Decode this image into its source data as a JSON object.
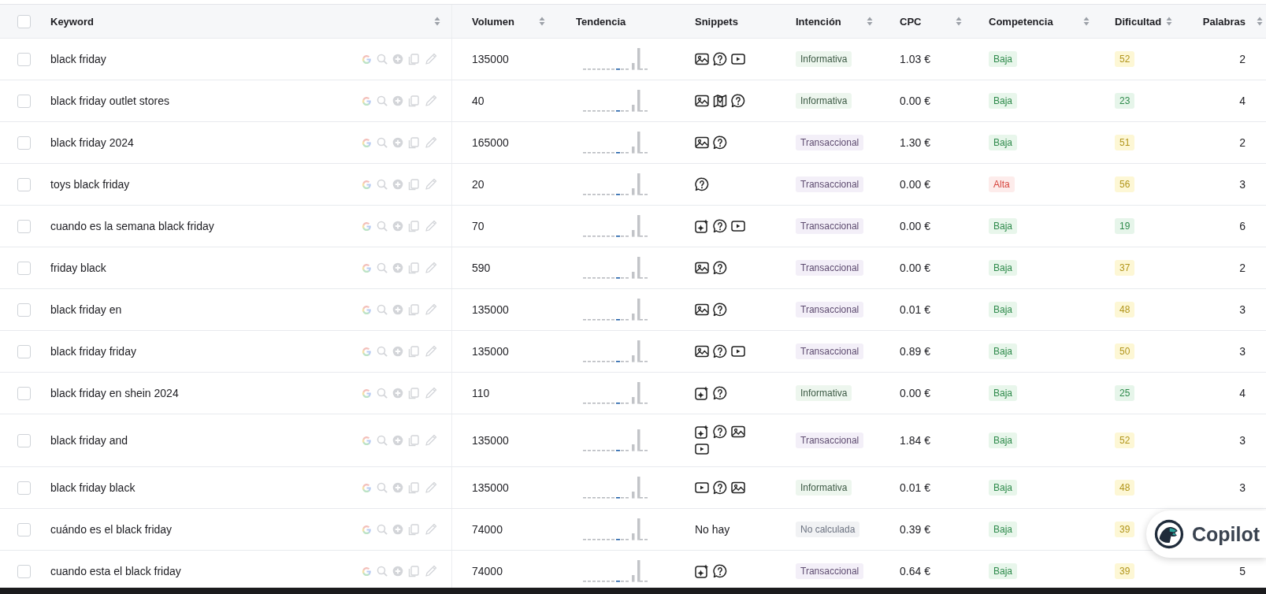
{
  "header": {
    "checkbox": {
      "checked": false
    },
    "columns": [
      {
        "label": "Keyword",
        "sortable": true
      },
      {
        "label": "Volumen",
        "sortable": true
      },
      {
        "label": "Tendencia",
        "sortable": false
      },
      {
        "label": "Snippets",
        "sortable": false
      },
      {
        "label": "Intención",
        "sortable": true
      },
      {
        "label": "CPC",
        "sortable": true
      },
      {
        "label": "Competencia",
        "sortable": true
      },
      {
        "label": "Dificultad",
        "sortable": true
      },
      {
        "label": "Palabras",
        "sortable": true
      }
    ]
  },
  "rows": [
    {
      "checked": false,
      "keyword": "black friday",
      "volume": "135000",
      "snippets": [
        {
          "kind": "image"
        },
        {
          "kind": "question"
        },
        {
          "kind": "video"
        }
      ],
      "intent": {
        "label": "Informativa",
        "kind": "informational"
      },
      "cpc": "1.03 €",
      "competition": {
        "label": "Baja",
        "kind": "low"
      },
      "difficulty": {
        "value": "52",
        "kind": "medium"
      },
      "words": "2"
    },
    {
      "checked": false,
      "keyword": "black friday outlet stores",
      "volume": "40",
      "snippets": [
        {
          "kind": "image"
        },
        {
          "kind": "map"
        },
        {
          "kind": "question"
        }
      ],
      "intent": {
        "label": "Informativa",
        "kind": "informational"
      },
      "cpc": "0.00 €",
      "competition": {
        "label": "Baja",
        "kind": "low"
      },
      "difficulty": {
        "value": "23",
        "kind": "easy"
      },
      "words": "4"
    },
    {
      "checked": false,
      "keyword": "black friday 2024",
      "volume": "165000",
      "snippets": [
        {
          "kind": "image"
        },
        {
          "kind": "question"
        }
      ],
      "intent": {
        "label": "Transaccional",
        "kind": "transactional"
      },
      "cpc": "1.30 €",
      "competition": {
        "label": "Baja",
        "kind": "low"
      },
      "difficulty": {
        "value": "51",
        "kind": "medium"
      },
      "words": "2"
    },
    {
      "checked": false,
      "keyword": "toys black friday",
      "volume": "20",
      "snippets": [
        {
          "kind": "question"
        }
      ],
      "intent": {
        "label": "Transaccional",
        "kind": "transactional"
      },
      "cpc": "0.00 €",
      "competition": {
        "label": "Alta",
        "kind": "high"
      },
      "difficulty": {
        "value": "56",
        "kind": "medium"
      },
      "words": "3"
    },
    {
      "checked": false,
      "keyword": "cuando es la semana black friday",
      "volume": "70",
      "snippets": [
        {
          "kind": "ai"
        },
        {
          "kind": "question"
        },
        {
          "kind": "video"
        }
      ],
      "intent": {
        "label": "Transaccional",
        "kind": "transactional"
      },
      "cpc": "0.00 €",
      "competition": {
        "label": "Baja",
        "kind": "low"
      },
      "difficulty": {
        "value": "19",
        "kind": "easy"
      },
      "words": "6"
    },
    {
      "checked": false,
      "keyword": "friday black",
      "volume": "590",
      "snippets": [
        {
          "kind": "image"
        },
        {
          "kind": "question"
        }
      ],
      "intent": {
        "label": "Transaccional",
        "kind": "transactional"
      },
      "cpc": "0.00 €",
      "competition": {
        "label": "Baja",
        "kind": "low"
      },
      "difficulty": {
        "value": "37",
        "kind": "medium"
      },
      "words": "2"
    },
    {
      "checked": false,
      "keyword": "black friday en",
      "volume": "135000",
      "snippets": [
        {
          "kind": "image"
        },
        {
          "kind": "question"
        }
      ],
      "intent": {
        "label": "Transaccional",
        "kind": "transactional"
      },
      "cpc": "0.01 €",
      "competition": {
        "label": "Baja",
        "kind": "low"
      },
      "difficulty": {
        "value": "48",
        "kind": "medium"
      },
      "words": "3"
    },
    {
      "checked": false,
      "keyword": "black friday friday",
      "volume": "135000",
      "snippets": [
        {
          "kind": "image"
        },
        {
          "kind": "question"
        },
        {
          "kind": "video"
        }
      ],
      "intent": {
        "label": "Transaccional",
        "kind": "transactional"
      },
      "cpc": "0.89 €",
      "competition": {
        "label": "Baja",
        "kind": "low"
      },
      "difficulty": {
        "value": "50",
        "kind": "medium"
      },
      "words": "3"
    },
    {
      "checked": false,
      "keyword": "black friday en shein 2024",
      "volume": "110",
      "snippets": [
        {
          "kind": "ai"
        },
        {
          "kind": "question"
        }
      ],
      "intent": {
        "label": "Informativa",
        "kind": "informational"
      },
      "cpc": "0.00 €",
      "competition": {
        "label": "Baja",
        "kind": "low"
      },
      "difficulty": {
        "value": "25",
        "kind": "easy"
      },
      "words": "4"
    },
    {
      "checked": false,
      "keyword": "black friday and",
      "volume": "135000",
      "snippets": [
        {
          "kind": "ai"
        },
        {
          "kind": "question"
        },
        {
          "kind": "image"
        },
        {
          "kind": "video"
        }
      ],
      "intent": {
        "label": "Transaccional",
        "kind": "transactional"
      },
      "cpc": "1.84 €",
      "competition": {
        "label": "Baja",
        "kind": "low"
      },
      "difficulty": {
        "value": "52",
        "kind": "medium"
      },
      "words": "3"
    },
    {
      "checked": false,
      "keyword": "black friday black",
      "volume": "135000",
      "snippets": [
        {
          "kind": "video"
        },
        {
          "kind": "question"
        },
        {
          "kind": "image"
        }
      ],
      "intent": {
        "label": "Informativa",
        "kind": "informational"
      },
      "cpc": "0.01 €",
      "competition": {
        "label": "Baja",
        "kind": "low"
      },
      "difficulty": {
        "value": "48",
        "kind": "medium"
      },
      "words": "3"
    },
    {
      "checked": false,
      "keyword": "cuándo es el black friday",
      "volume": "74000",
      "snippets_text": "No hay",
      "intent": {
        "label": "No calculada",
        "kind": "none"
      },
      "cpc": "0.39 €",
      "competition": {
        "label": "Baja",
        "kind": "low"
      },
      "difficulty": {
        "value": "39",
        "kind": "medium"
      }
    },
    {
      "checked": false,
      "keyword": "cuando esta el black friday",
      "volume": "74000",
      "snippets": [
        {
          "kind": "ai"
        },
        {
          "kind": "question"
        }
      ],
      "intent": {
        "label": "Transaccional",
        "kind": "transactional"
      },
      "cpc": "0.64 €",
      "competition": {
        "label": "Baja",
        "kind": "low"
      },
      "difficulty": {
        "value": "39",
        "kind": "medium"
      },
      "words": "5"
    }
  ],
  "copilot": {
    "label": "Copilot"
  }
}
